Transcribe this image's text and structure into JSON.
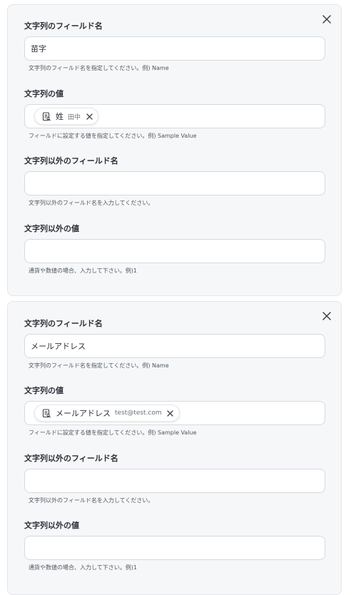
{
  "cards": [
    {
      "string_field_name": {
        "label": "文字列のフィールド名",
        "value": "苗字",
        "help": "文字列のフィールド名を指定してください。例) Name"
      },
      "string_value": {
        "label": "文字列の値",
        "chip_name": "姓",
        "chip_sample": "田中",
        "help": "フィールドに設定する値を指定してください。例) Sample Value"
      },
      "non_string_field_name": {
        "label": "文字列以外のフィールド名",
        "value": "",
        "help": "文字列以外のフィールド名を入力してください。"
      },
      "non_string_value": {
        "label": "文字列以外の値",
        "value": "",
        "help": "通貨や数値の場合、入力して下さい。例)1"
      }
    },
    {
      "string_field_name": {
        "label": "文字列のフィールド名",
        "value": "メールアドレス",
        "help": "文字列のフィールド名を指定してください。例) Name"
      },
      "string_value": {
        "label": "文字列の値",
        "chip_name": "メールアドレス",
        "chip_sample": "test@test.com",
        "help": "フィールドに設定する値を指定してください。例) Sample Value"
      },
      "non_string_field_name": {
        "label": "文字列以外のフィールド名",
        "value": "",
        "help": "文字列以外のフィールド名を入力してください。"
      },
      "non_string_value": {
        "label": "文字列以外の値",
        "value": "",
        "help": "通貨や数値の場合、入力して下さい。例)1"
      }
    }
  ],
  "icons": {
    "close": "close-icon",
    "chip_field": "document-field-icon",
    "chip_remove": "remove-icon"
  },
  "colors": {
    "card_background": "#f6f7f9",
    "border": "#d6d9de",
    "text": "#2b2f36",
    "help_text": "#50555d"
  }
}
